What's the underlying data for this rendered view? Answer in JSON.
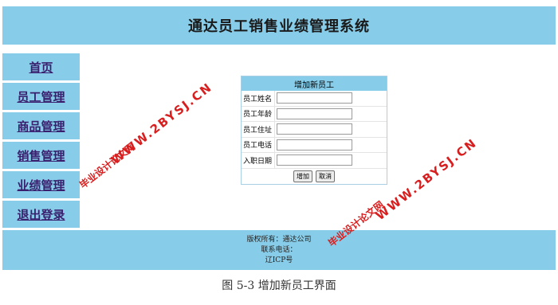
{
  "header": {
    "title": "通达员工销售业绩管理系统"
  },
  "sidebar": {
    "items": [
      {
        "label": "首页"
      },
      {
        "label": "员工管理"
      },
      {
        "label": "商品管理"
      },
      {
        "label": "销售管理"
      },
      {
        "label": "业绩管理"
      },
      {
        "label": "退出登录"
      }
    ]
  },
  "form": {
    "title": "增加新员工",
    "fields": [
      {
        "label": "员工姓名",
        "value": ""
      },
      {
        "label": "员工年龄",
        "value": ""
      },
      {
        "label": "员工住址",
        "value": ""
      },
      {
        "label": "员工电话",
        "value": ""
      },
      {
        "label": "入职日期",
        "value": ""
      }
    ],
    "add_button": "增加",
    "cancel_button": "取消"
  },
  "footer": {
    "copyright": "版权所有：通达公司",
    "contact": "联系电话：",
    "icp": "辽ICP号"
  },
  "caption": "图 5-3  增加新员工界面",
  "watermarks": [
    {
      "line1": "毕业设计论文网",
      "line2": "WWW.2BYSJ.CN"
    },
    {
      "line1": "毕业设计论文网",
      "line2": "WWW.2BYSJ.CN"
    }
  ],
  "colors": {
    "bar": "#87cce8",
    "link": "#3a1f6e",
    "watermark": "#d81e1e"
  }
}
